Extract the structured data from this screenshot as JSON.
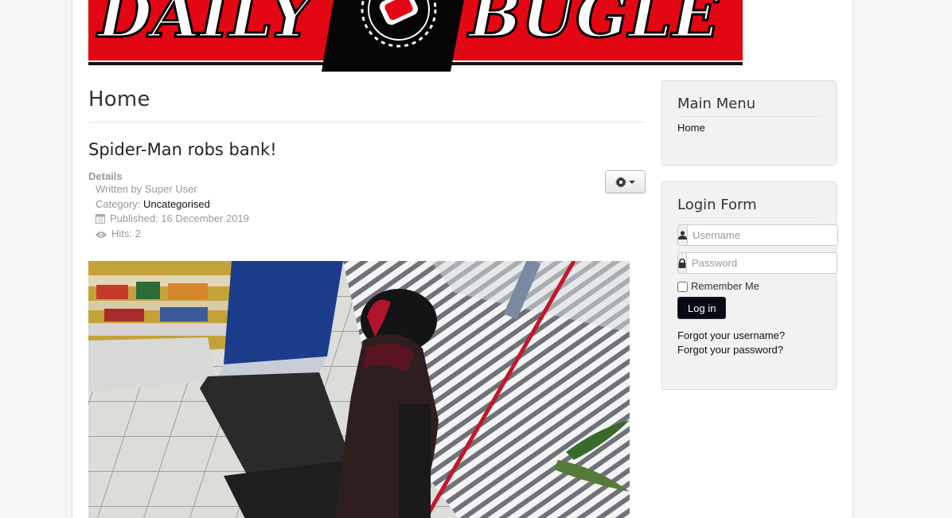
{
  "header": {
    "logo_text_left": "DAILY",
    "logo_text_right": "BUGLE",
    "logo_color": "#e30613"
  },
  "main": {
    "page_title": "Home",
    "article": {
      "title": "Spider-Man robs bank!",
      "tools_icon": "gear-icon",
      "details_label": "Details",
      "written_by": "Written by Super User",
      "category_prefix": "Category: ",
      "category_link": "Uncategorised",
      "published": "Published: 16 December 2019",
      "hits": "Hits: 2",
      "image_icon": "security-camera-photo"
    }
  },
  "sidebar": {
    "main_menu": {
      "title": "Main Menu",
      "items": [
        {
          "label": "Home"
        }
      ]
    },
    "login_form": {
      "title": "Login Form",
      "username_placeholder": "Username",
      "password_placeholder": "Password",
      "remember_label": "Remember Me",
      "login_button": "Log in",
      "forgot_username": "Forgot your username?",
      "forgot_password": "Forgot your password?"
    }
  }
}
